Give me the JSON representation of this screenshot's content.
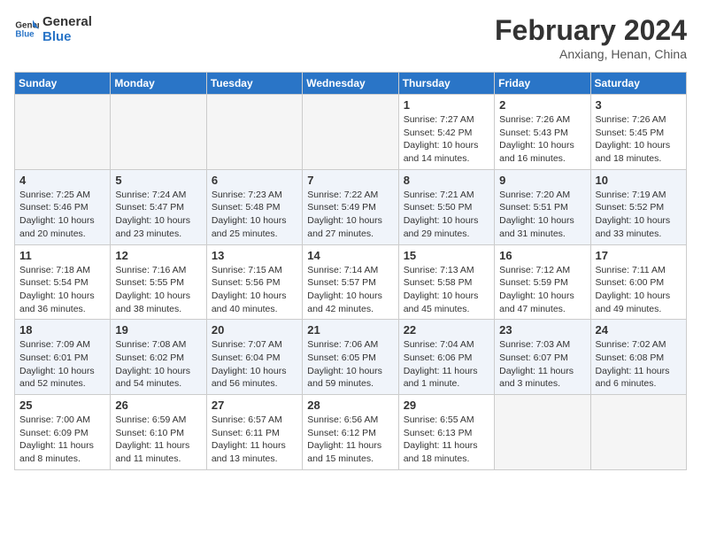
{
  "logo": {
    "line1": "General",
    "line2": "Blue"
  },
  "title": "February 2024",
  "subtitle": "Anxiang, Henan, China",
  "weekdays": [
    "Sunday",
    "Monday",
    "Tuesday",
    "Wednesday",
    "Thursday",
    "Friday",
    "Saturday"
  ],
  "weeks": [
    [
      {
        "day": "",
        "info": ""
      },
      {
        "day": "",
        "info": ""
      },
      {
        "day": "",
        "info": ""
      },
      {
        "day": "",
        "info": ""
      },
      {
        "day": "1",
        "info": "Sunrise: 7:27 AM\nSunset: 5:42 PM\nDaylight: 10 hours\nand 14 minutes."
      },
      {
        "day": "2",
        "info": "Sunrise: 7:26 AM\nSunset: 5:43 PM\nDaylight: 10 hours\nand 16 minutes."
      },
      {
        "day": "3",
        "info": "Sunrise: 7:26 AM\nSunset: 5:45 PM\nDaylight: 10 hours\nand 18 minutes."
      }
    ],
    [
      {
        "day": "4",
        "info": "Sunrise: 7:25 AM\nSunset: 5:46 PM\nDaylight: 10 hours\nand 20 minutes."
      },
      {
        "day": "5",
        "info": "Sunrise: 7:24 AM\nSunset: 5:47 PM\nDaylight: 10 hours\nand 23 minutes."
      },
      {
        "day": "6",
        "info": "Sunrise: 7:23 AM\nSunset: 5:48 PM\nDaylight: 10 hours\nand 25 minutes."
      },
      {
        "day": "7",
        "info": "Sunrise: 7:22 AM\nSunset: 5:49 PM\nDaylight: 10 hours\nand 27 minutes."
      },
      {
        "day": "8",
        "info": "Sunrise: 7:21 AM\nSunset: 5:50 PM\nDaylight: 10 hours\nand 29 minutes."
      },
      {
        "day": "9",
        "info": "Sunrise: 7:20 AM\nSunset: 5:51 PM\nDaylight: 10 hours\nand 31 minutes."
      },
      {
        "day": "10",
        "info": "Sunrise: 7:19 AM\nSunset: 5:52 PM\nDaylight: 10 hours\nand 33 minutes."
      }
    ],
    [
      {
        "day": "11",
        "info": "Sunrise: 7:18 AM\nSunset: 5:54 PM\nDaylight: 10 hours\nand 36 minutes."
      },
      {
        "day": "12",
        "info": "Sunrise: 7:16 AM\nSunset: 5:55 PM\nDaylight: 10 hours\nand 38 minutes."
      },
      {
        "day": "13",
        "info": "Sunrise: 7:15 AM\nSunset: 5:56 PM\nDaylight: 10 hours\nand 40 minutes."
      },
      {
        "day": "14",
        "info": "Sunrise: 7:14 AM\nSunset: 5:57 PM\nDaylight: 10 hours\nand 42 minutes."
      },
      {
        "day": "15",
        "info": "Sunrise: 7:13 AM\nSunset: 5:58 PM\nDaylight: 10 hours\nand 45 minutes."
      },
      {
        "day": "16",
        "info": "Sunrise: 7:12 AM\nSunset: 5:59 PM\nDaylight: 10 hours\nand 47 minutes."
      },
      {
        "day": "17",
        "info": "Sunrise: 7:11 AM\nSunset: 6:00 PM\nDaylight: 10 hours\nand 49 minutes."
      }
    ],
    [
      {
        "day": "18",
        "info": "Sunrise: 7:09 AM\nSunset: 6:01 PM\nDaylight: 10 hours\nand 52 minutes."
      },
      {
        "day": "19",
        "info": "Sunrise: 7:08 AM\nSunset: 6:02 PM\nDaylight: 10 hours\nand 54 minutes."
      },
      {
        "day": "20",
        "info": "Sunrise: 7:07 AM\nSunset: 6:04 PM\nDaylight: 10 hours\nand 56 minutes."
      },
      {
        "day": "21",
        "info": "Sunrise: 7:06 AM\nSunset: 6:05 PM\nDaylight: 10 hours\nand 59 minutes."
      },
      {
        "day": "22",
        "info": "Sunrise: 7:04 AM\nSunset: 6:06 PM\nDaylight: 11 hours\nand 1 minute."
      },
      {
        "day": "23",
        "info": "Sunrise: 7:03 AM\nSunset: 6:07 PM\nDaylight: 11 hours\nand 3 minutes."
      },
      {
        "day": "24",
        "info": "Sunrise: 7:02 AM\nSunset: 6:08 PM\nDaylight: 11 hours\nand 6 minutes."
      }
    ],
    [
      {
        "day": "25",
        "info": "Sunrise: 7:00 AM\nSunset: 6:09 PM\nDaylight: 11 hours\nand 8 minutes."
      },
      {
        "day": "26",
        "info": "Sunrise: 6:59 AM\nSunset: 6:10 PM\nDaylight: 11 hours\nand 11 minutes."
      },
      {
        "day": "27",
        "info": "Sunrise: 6:57 AM\nSunset: 6:11 PM\nDaylight: 11 hours\nand 13 minutes."
      },
      {
        "day": "28",
        "info": "Sunrise: 6:56 AM\nSunset: 6:12 PM\nDaylight: 11 hours\nand 15 minutes."
      },
      {
        "day": "29",
        "info": "Sunrise: 6:55 AM\nSunset: 6:13 PM\nDaylight: 11 hours\nand 18 minutes."
      },
      {
        "day": "",
        "info": ""
      },
      {
        "day": "",
        "info": ""
      }
    ]
  ]
}
